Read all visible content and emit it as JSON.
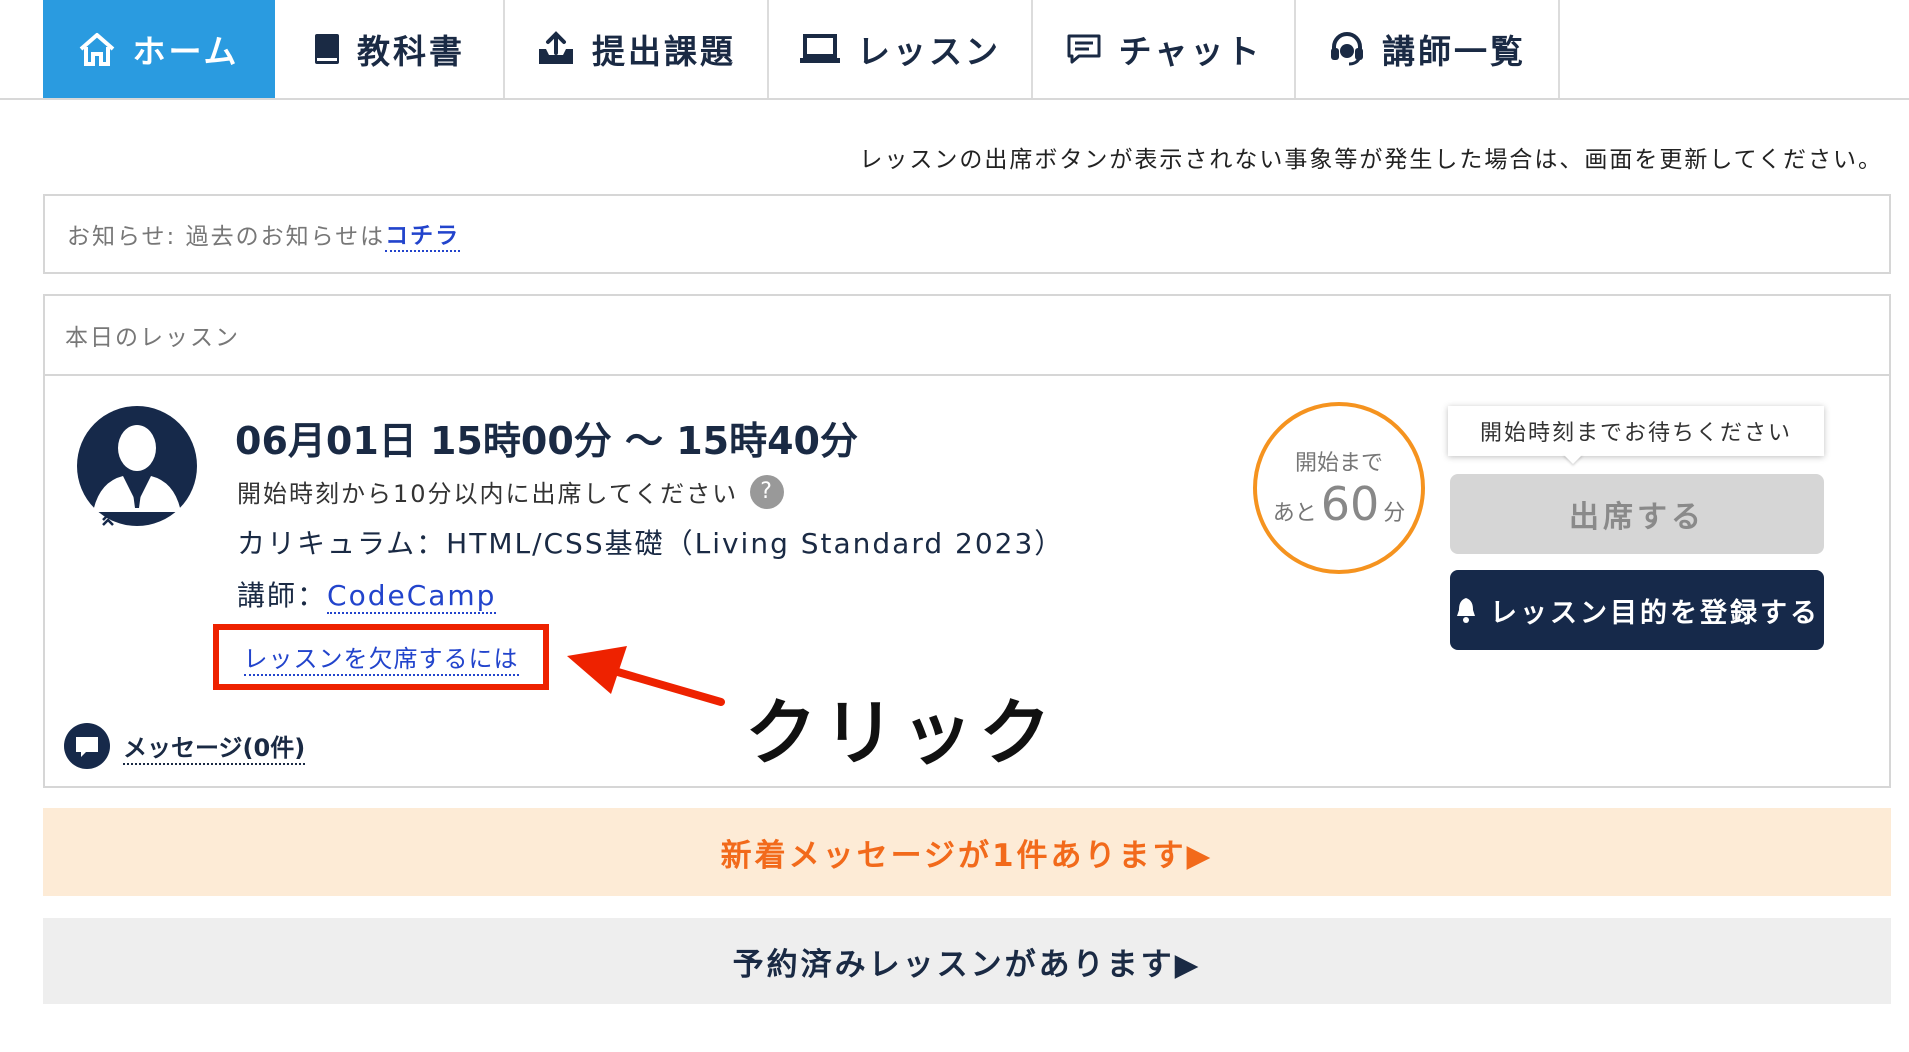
{
  "nav": {
    "items": [
      {
        "label": "ホーム",
        "icon": "home-icon",
        "active": true
      },
      {
        "label": "教科書",
        "icon": "book-icon",
        "active": false
      },
      {
        "label": "提出課題",
        "icon": "upload-tray-icon",
        "active": false
      },
      {
        "label": "レッスン",
        "icon": "laptop-icon",
        "active": false
      },
      {
        "label": "チャット",
        "icon": "chat-icon",
        "active": false
      },
      {
        "label": "講師一覧",
        "icon": "headset-icon",
        "active": false
      }
    ]
  },
  "refresh_note": "レッスンの出席ボタンが表示されない事象等が発生した場合は、画面を更新してください。",
  "notice": {
    "prefix": "お知らせ:  過去のお知らせは",
    "link": "コチラ"
  },
  "lesson": {
    "header": "本日のレッスン",
    "time": "06月01日 15時00分 〜 15時40分",
    "attend_note": "開始時刻から10分以内に出席してください",
    "help": "?",
    "curriculum": "カリキュラム：HTML/CSS基礎（Living Standard 2023）",
    "teacher_label": "講師：",
    "teacher_name": "CodeCamp",
    "absent_link": "レッスンを欠席するには",
    "annotation": "クリック",
    "message_link": "メッセージ(0件)",
    "countdown": {
      "label": "開始まで",
      "prefix": "あと",
      "value": "60",
      "unit": "分"
    },
    "tooltip": "開始時刻までお待ちください",
    "attend_button": "出席する",
    "goal_button": "レッスン目的を登録する"
  },
  "banners": {
    "new_message": "新着メッセージが1件あります▶",
    "reserved": "予約済みレッスンがあります▶"
  },
  "colors": {
    "active_tab": "#2a9be0",
    "navy": "#16294a",
    "countdown_ring": "#f5931f",
    "highlight_red": "#ee2200",
    "new_banner_bg": "#fdebd6",
    "new_banner_text": "#f26a1b"
  }
}
